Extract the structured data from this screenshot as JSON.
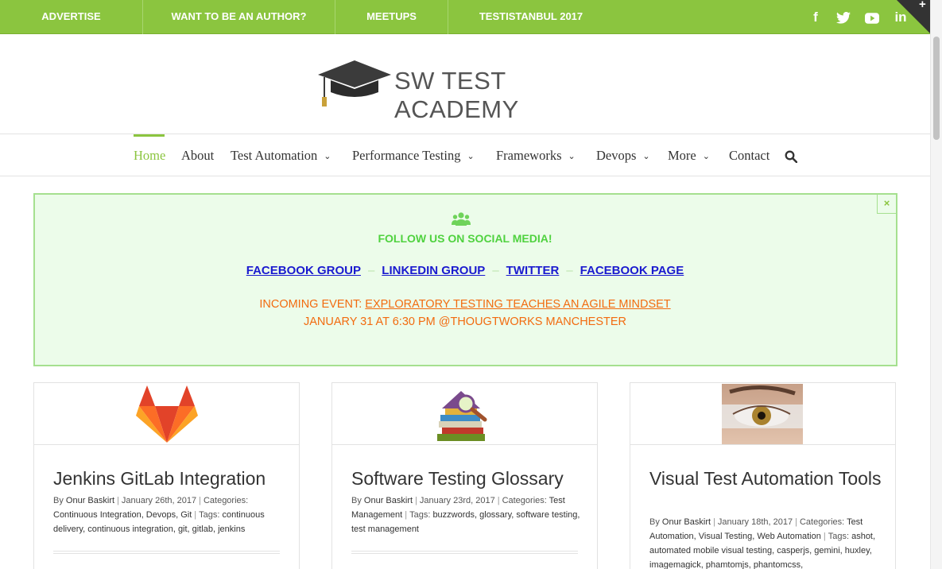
{
  "topbar": {
    "links": [
      "ADVERTISE",
      "WANT TO BE AN AUTHOR?",
      "MEETUPS",
      "TESTISTANBUL 2017"
    ],
    "social_icons": [
      "facebook-icon",
      "twitter-icon",
      "youtube-icon",
      "linkedin-icon"
    ]
  },
  "logo": {
    "text": "SW TEST ACADEMY"
  },
  "nav": {
    "items": [
      "Home",
      "About",
      "Test Automation",
      "Performance Testing",
      "Frameworks",
      "Devops",
      "More",
      "Contact"
    ],
    "active": "Home"
  },
  "notice": {
    "heading": "FOLLOW US ON SOCIAL MEDIA!",
    "links": [
      "FACEBOOK GROUP",
      "LINKEDIN GROUP",
      "TWITTER",
      "FACEBOOK PAGE"
    ],
    "separator": "–",
    "event_prefix": "INCOMING EVENT: ",
    "event_link": "EXPLORATORY TESTING TEACHES AN AGILE MINDSET",
    "event_line2": "JANUARY 31 AT 6:30 PM @THOUGTWORKS MANCHESTER",
    "close": "×"
  },
  "colors": {
    "accent": "#8bc53f",
    "notice_bg": "#ecfcea",
    "notice_heading": "#4fd23f",
    "link_blue": "#1a1acf",
    "event_orange": "#f26b0f"
  },
  "posts": [
    {
      "title": "Jenkins GitLab Integration",
      "by": "By ",
      "author": "Onur Baskirt",
      "date": "January 26th, 2017",
      "categories_label": "Categories: ",
      "categories": "Continuous Integration, Devops, Git",
      "tags_label": "Tags: ",
      "tags": "continuous delivery, continuous integration, git, gitlab, jenkins",
      "image": "gitlab-logo"
    },
    {
      "title": "Software Testing Glossary",
      "by": "By ",
      "author": "Onur Baskirt",
      "date": "January 23rd, 2017",
      "categories_label": "Categories: ",
      "categories": "Test Management",
      "tags_label": "Tags: ",
      "tags": "buzzwords, glossary, software testing, test management",
      "image": "books-magnifier"
    },
    {
      "title": "Visual Test Automation Tools",
      "by": "By ",
      "author": "Onur Baskirt",
      "date": "January 18th, 2017",
      "categories_label": "Categories: ",
      "categories": "Test Automation, Visual Testing, Web Automation",
      "tags_label": "Tags: ",
      "tags": "ashot, automated mobile visual testing, casperjs, gemini, huxley, imagemagick, phamtomjs, phantomcss,",
      "image": "eye-photo"
    }
  ]
}
